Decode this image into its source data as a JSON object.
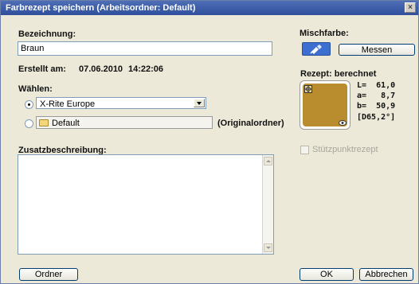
{
  "window": {
    "title": "Farbrezept speichern (Arbeitsordner: Default)",
    "close_glyph": "×"
  },
  "name": {
    "label": "Bezeichnung:",
    "value": "Braun"
  },
  "created": {
    "label": "Erstellt am:",
    "date": "07.06.2010",
    "time": "14:22:06"
  },
  "choose": {
    "label": "Wählen:",
    "option1_value": "X-Rite Europe",
    "option2_value": "Default",
    "option2_note": "(Originalordner)"
  },
  "description": {
    "label": "Zusatzbeschreibung:",
    "value": ""
  },
  "mix": {
    "label": "Mischfarbe:",
    "measure_label": "Messen"
  },
  "recipe": {
    "label": "Rezept: berechnet",
    "swatch_color": "#b98c2e",
    "L_line": "L=  61,0",
    "a_line": "a=   8,7",
    "b_line": "b=  50,9",
    "illuminant": "[D65,2°]"
  },
  "support": {
    "label": "Stützpunktrezept",
    "checked": false
  },
  "buttons": {
    "folder": "Ordner",
    "ok": "OK",
    "cancel": "Abbrechen"
  },
  "colors": {
    "titlebar": "#2f4f9c",
    "dialog_bg": "#ece9d8",
    "toggle_blue": "#3d6fd1"
  }
}
